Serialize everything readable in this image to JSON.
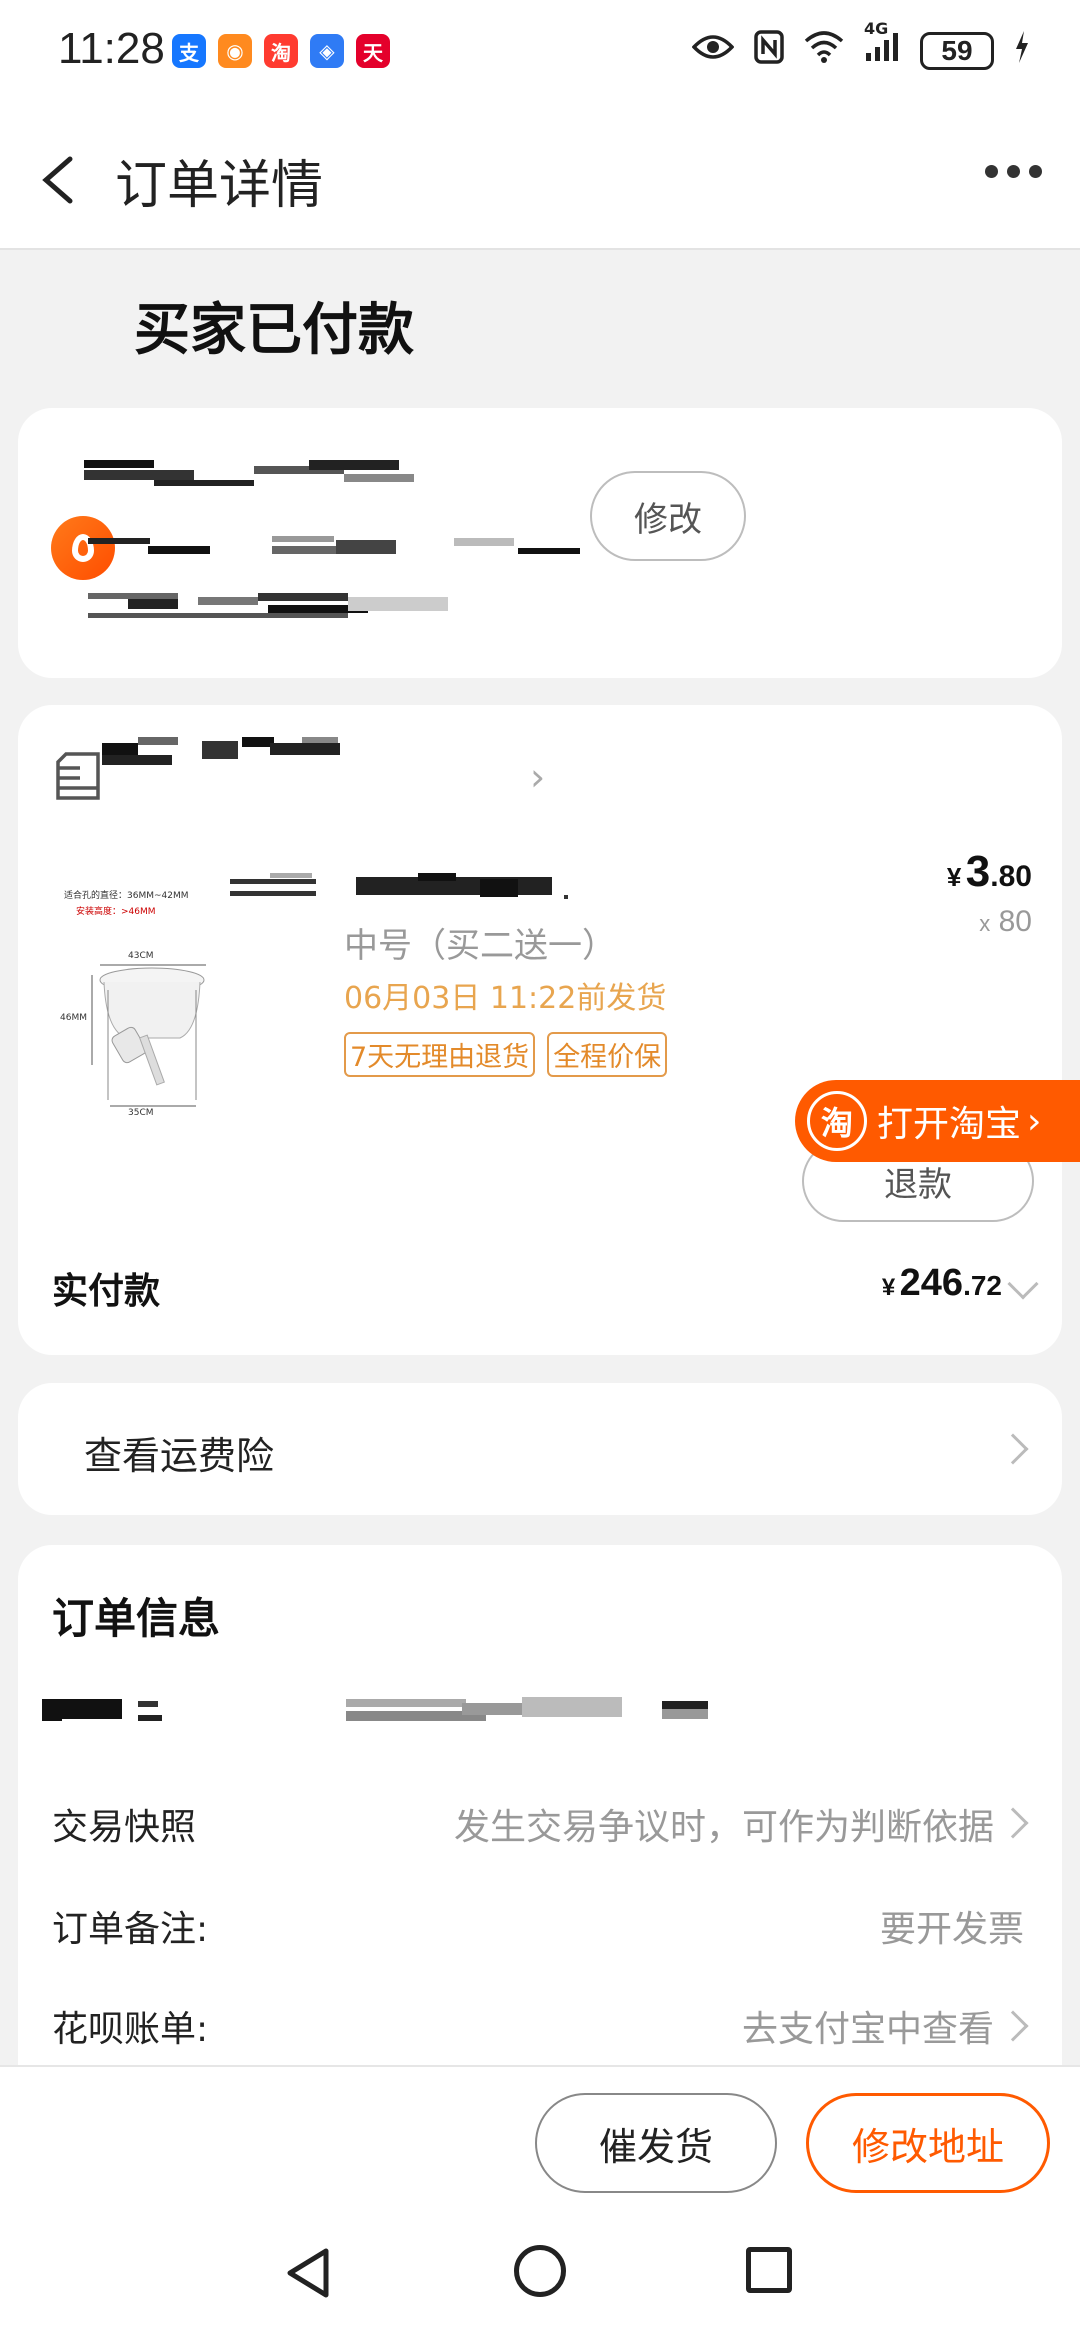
{
  "status_bar": {
    "time": "11:28",
    "app_icons": [
      {
        "name": "alipay-icon",
        "glyph": "支",
        "color": "#1677ff"
      },
      {
        "name": "app-orange-icon",
        "glyph": "◉",
        "color": "#ff8a1f"
      },
      {
        "name": "taobao-icon",
        "glyph": "淘",
        "color": "#ff3b30"
      },
      {
        "name": "app-blue-icon",
        "glyph": "◈",
        "color": "#2f7bf5"
      },
      {
        "name": "tmall-icon",
        "glyph": "天",
        "color": "#e4002b"
      }
    ],
    "network": "4G",
    "battery": "59"
  },
  "nav": {
    "title": "订单详情"
  },
  "order_status": "买家已付款",
  "address": {
    "edit_label": "修改"
  },
  "product": {
    "variant": "中号（买二送一）",
    "ship_by": "06月03日 11:22前发货",
    "tags": [
      "7天无理由退货",
      "全程价保"
    ],
    "price_symbol": "¥",
    "price_int": "3",
    "price_dec": ".80",
    "qty_prefix": "x",
    "qty": "80",
    "refund_label": "退款",
    "image_text": {
      "line1": "适合孔的直径：36MM~42MM",
      "line2": "安装高度：>46MM",
      "dim_top": "43CM",
      "dim_left": "46MM",
      "dim_bottom": "35CM"
    }
  },
  "payment": {
    "label": "实付款",
    "symbol": "¥",
    "amount_int": "246",
    "amount_dec": ".72"
  },
  "open_taobao": {
    "logo": "淘",
    "label": "打开淘宝"
  },
  "insurance": {
    "label": "查看运费险"
  },
  "order_info": {
    "title": "订单信息",
    "rows": [
      {
        "label": "交易快照",
        "value": "发生交易争议时，可作为判断依据"
      },
      {
        "label": "订单备注:",
        "value": "要开发票"
      },
      {
        "label": "花呗账单:",
        "value": "去支付宝中查看"
      }
    ]
  },
  "actions": {
    "urge": "催发货",
    "edit_address": "修改地址"
  },
  "colors": {
    "accent": "#ff5a00",
    "ship_text": "#e8a54f",
    "tag_border": "#e39a4a"
  }
}
